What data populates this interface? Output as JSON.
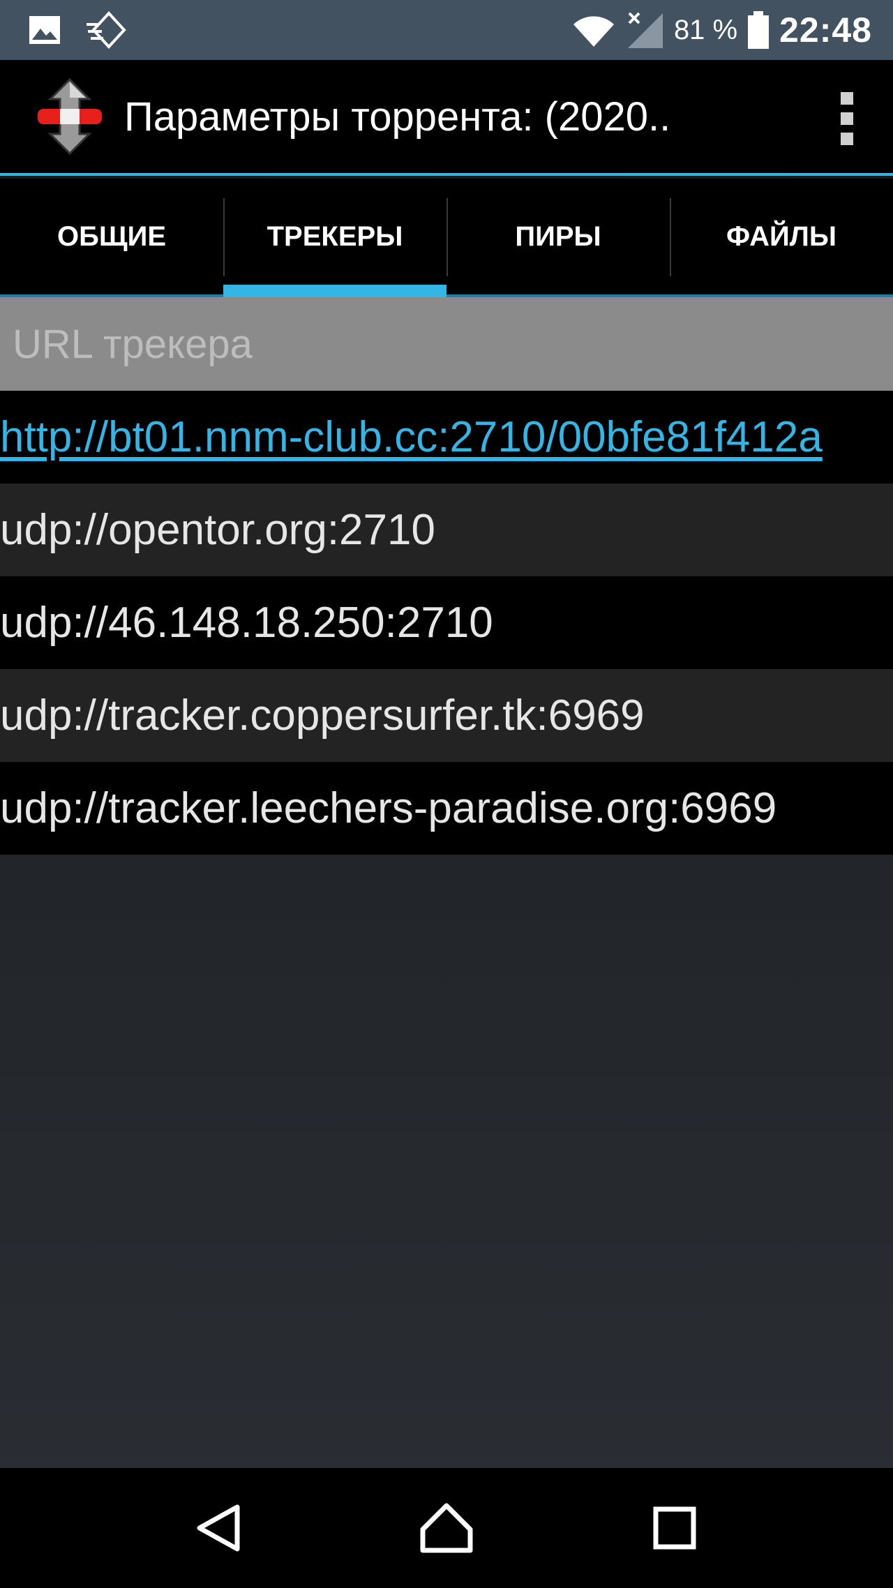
{
  "status_bar": {
    "battery_percent": "81 %",
    "time": "22:48",
    "icons": [
      "image-notification-icon",
      "sync-notification-icon",
      "wifi-icon",
      "signal-icon",
      "battery-icon"
    ]
  },
  "action_bar": {
    "title": "Параметры торрента: (2020..",
    "app_icon": "torrent-app-icon",
    "overflow_icon": "overflow-menu-icon"
  },
  "tabs": [
    {
      "label": "ОБЩИЕ",
      "active": false
    },
    {
      "label": "ТРЕКЕРЫ",
      "active": true
    },
    {
      "label": "ПИРЫ",
      "active": false
    },
    {
      "label": "ФАЙЛЫ",
      "active": false
    }
  ],
  "list_header": "URL трекера",
  "trackers": [
    "http://bt01.nnm-club.cc:2710/00bfe81f412a",
    "udp://opentor.org:2710",
    "udp://46.148.18.250:2710",
    "udp://tracker.coppersurfer.tk:6969",
    "udp://tracker.leechers-paradise.org:6969"
  ],
  "nav_bar": {
    "icons": [
      "back-icon",
      "home-icon",
      "recents-icon"
    ]
  },
  "colors": {
    "accent": "#33b5e5",
    "status_bar": "#425261",
    "header_row": "#8b8b8b"
  }
}
